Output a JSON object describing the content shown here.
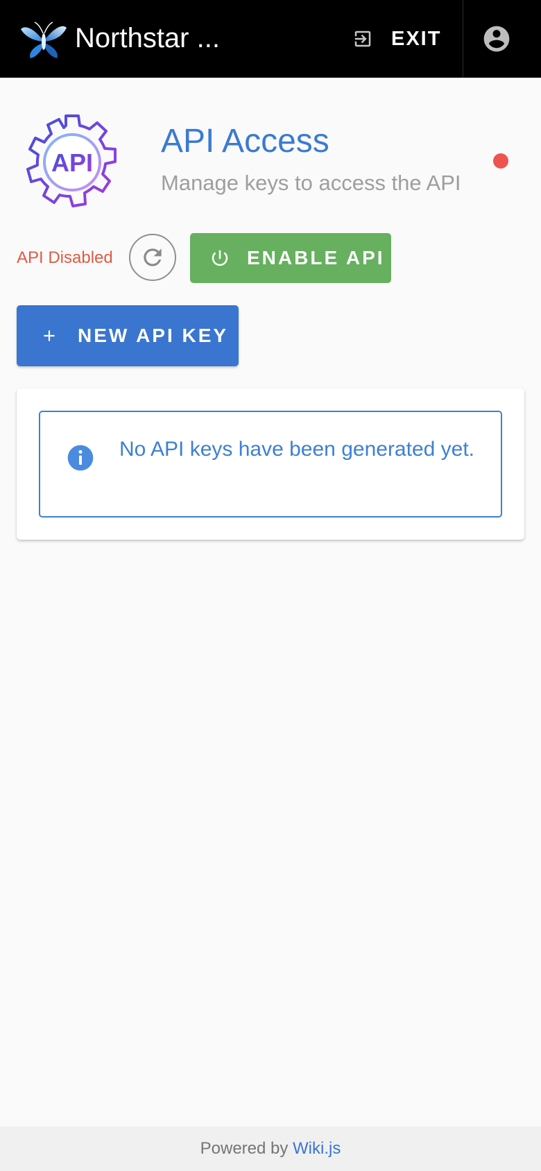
{
  "topbar": {
    "site_title": "Northstar ...",
    "exit_label": "EXIT",
    "exit_icon": "exit-to-app-icon",
    "account_icon": "account-circle-icon",
    "logo": "wikijs-butterfly-logo"
  },
  "header": {
    "icon": "api-gear-icon",
    "icon_text": "API",
    "title": "API Access",
    "subtitle": "Manage keys to access the API",
    "status_dot_color": "#ef5350"
  },
  "actions": {
    "api_status": "API Disabled",
    "refresh_icon": "refresh-icon",
    "enable_label": "ENABLE API",
    "enable_icon": "power-icon",
    "new_key_label": "NEW API KEY",
    "new_key_icon": "plus-icon"
  },
  "alert": {
    "icon": "info-icon",
    "message": "No API keys have been generated yet."
  },
  "footer": {
    "prefix": "Powered by ",
    "link_text": "Wiki.js"
  },
  "colors": {
    "primary": "#3a75cf",
    "success": "#66b05f",
    "error": "#e05a44",
    "info": "#3d7fd4"
  }
}
